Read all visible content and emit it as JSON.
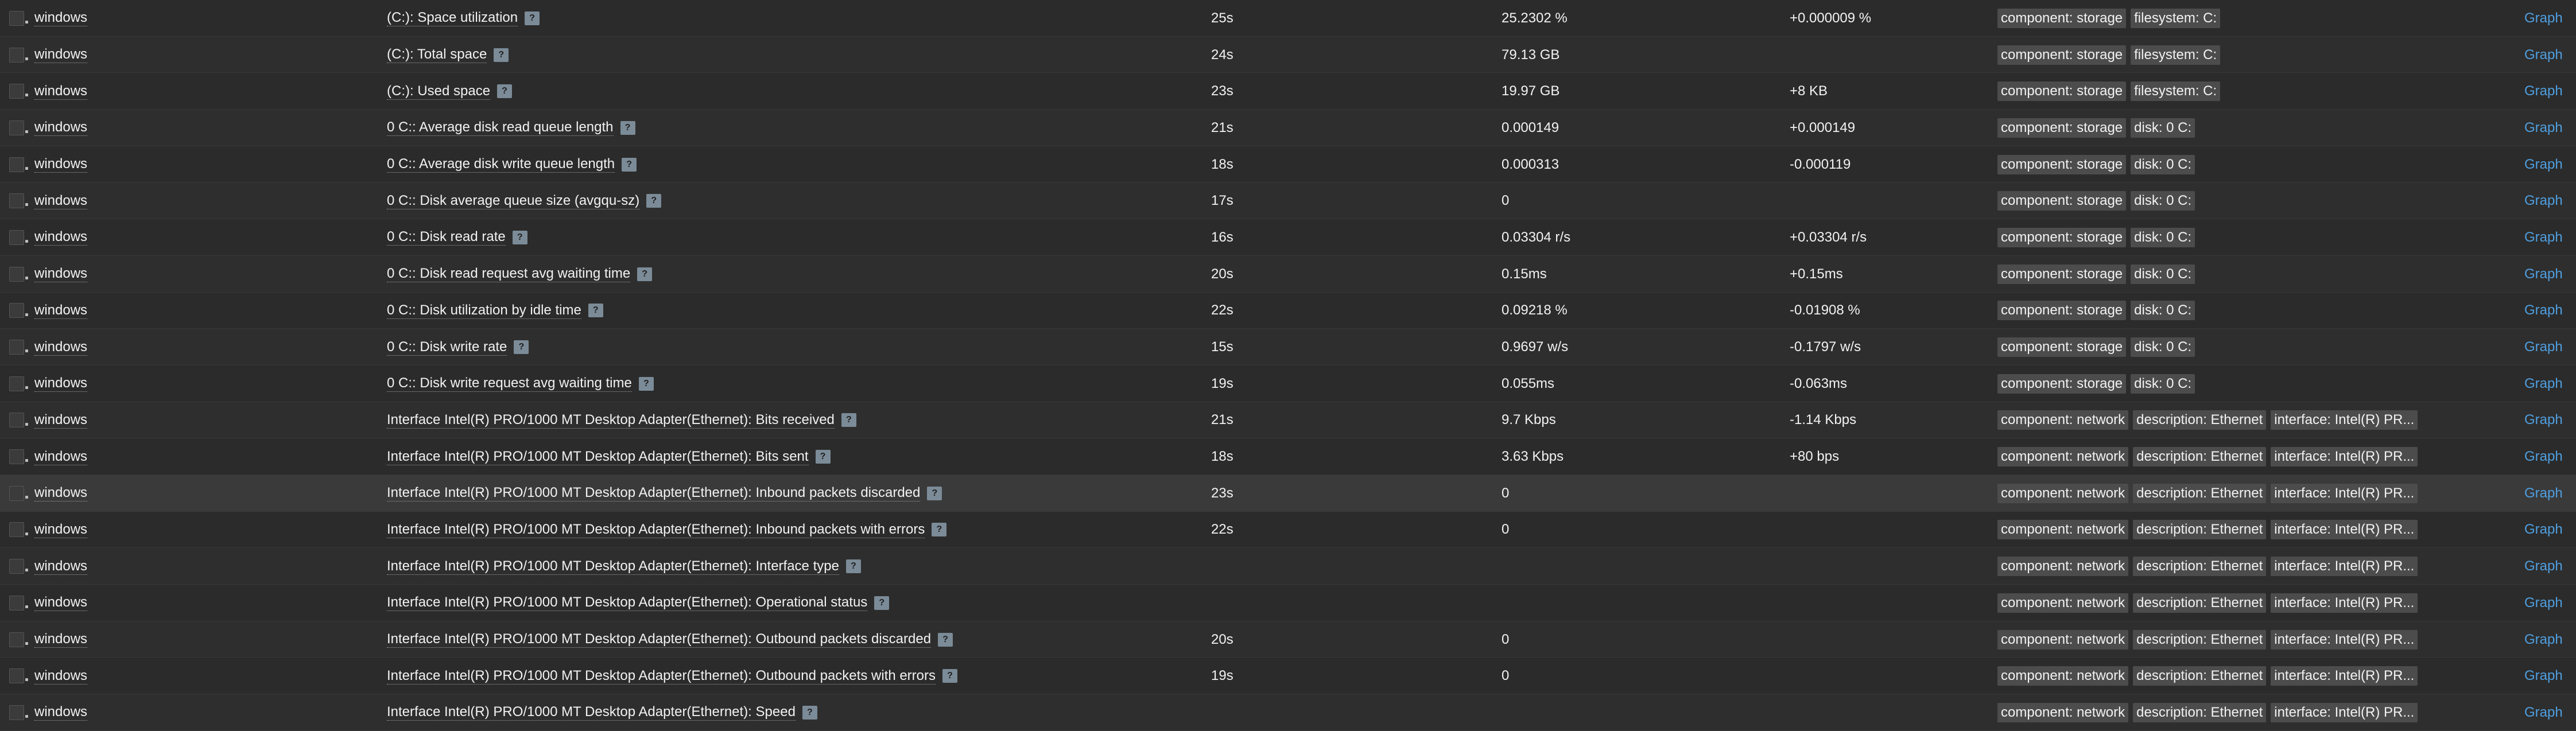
{
  "colors": {
    "background": "#2b2b2b",
    "link_blue": "#4f9fe0",
    "tag_bg": "#4c4c4c",
    "help_bg": "#7b8b97"
  },
  "help_label": "?",
  "rows": [
    {
      "host": "windows",
      "name": "(C:): Space utilization",
      "last_check": "25s",
      "last_value": "25.2302 %",
      "change": "+0.000009 %",
      "tags": [
        "component: storage",
        "filesystem: C:"
      ],
      "action": "Graph"
    },
    {
      "host": "windows",
      "name": "(C:): Total space",
      "last_check": "24s",
      "last_value": "79.13 GB",
      "change": "",
      "tags": [
        "component: storage",
        "filesystem: C:"
      ],
      "action": "Graph"
    },
    {
      "host": "windows",
      "name": "(C:): Used space",
      "last_check": "23s",
      "last_value": "19.97 GB",
      "change": "+8 KB",
      "tags": [
        "component: storage",
        "filesystem: C:"
      ],
      "action": "Graph"
    },
    {
      "host": "windows",
      "name": "0 C:: Average disk read queue length",
      "last_check": "21s",
      "last_value": "0.000149",
      "change": "+0.000149",
      "tags": [
        "component: storage",
        "disk: 0 C:"
      ],
      "action": "Graph"
    },
    {
      "host": "windows",
      "name": "0 C:: Average disk write queue length",
      "last_check": "18s",
      "last_value": "0.000313",
      "change": "-0.000119",
      "tags": [
        "component: storage",
        "disk: 0 C:"
      ],
      "action": "Graph"
    },
    {
      "host": "windows",
      "name": "0 C:: Disk average queue size (avgqu-sz)",
      "last_check": "17s",
      "last_value": "0",
      "change": "",
      "tags": [
        "component: storage",
        "disk: 0 C:"
      ],
      "action": "Graph"
    },
    {
      "host": "windows",
      "name": "0 C:: Disk read rate",
      "last_check": "16s",
      "last_value": "0.03304 r/s",
      "change": "+0.03304 r/s",
      "tags": [
        "component: storage",
        "disk: 0 C:"
      ],
      "action": "Graph"
    },
    {
      "host": "windows",
      "name": "0 C:: Disk read request avg waiting time",
      "last_check": "20s",
      "last_value": "0.15ms",
      "change": "+0.15ms",
      "tags": [
        "component: storage",
        "disk: 0 C:"
      ],
      "action": "Graph"
    },
    {
      "host": "windows",
      "name": "0 C:: Disk utilization by idle time",
      "last_check": "22s",
      "last_value": "0.09218 %",
      "change": "-0.01908 %",
      "tags": [
        "component: storage",
        "disk: 0 C:"
      ],
      "action": "Graph"
    },
    {
      "host": "windows",
      "name": "0 C:: Disk write rate",
      "last_check": "15s",
      "last_value": "0.9697 w/s",
      "change": "-0.1797 w/s",
      "tags": [
        "component: storage",
        "disk: 0 C:"
      ],
      "action": "Graph"
    },
    {
      "host": "windows",
      "name": "0 C:: Disk write request avg waiting time",
      "last_check": "19s",
      "last_value": "0.055ms",
      "change": "-0.063ms",
      "tags": [
        "component: storage",
        "disk: 0 C:"
      ],
      "action": "Graph"
    },
    {
      "host": "windows",
      "name": "Interface Intel(R) PRO/1000 MT Desktop Adapter(Ethernet): Bits received",
      "last_check": "21s",
      "last_value": "9.7 Kbps",
      "change": "-1.14 Kbps",
      "tags": [
        "component: network",
        "description: Ethernet",
        "interface: Intel(R) PR..."
      ],
      "action": "Graph"
    },
    {
      "host": "windows",
      "name": "Interface Intel(R) PRO/1000 MT Desktop Adapter(Ethernet): Bits sent",
      "last_check": "18s",
      "last_value": "3.63 Kbps",
      "change": "+80 bps",
      "tags": [
        "component: network",
        "description: Ethernet",
        "interface: Intel(R) PR..."
      ],
      "action": "Graph"
    },
    {
      "host": "windows",
      "name": "Interface Intel(R) PRO/1000 MT Desktop Adapter(Ethernet): Inbound packets discarded",
      "last_check": "23s",
      "last_value": "0",
      "change": "",
      "tags": [
        "component: network",
        "description: Ethernet",
        "interface: Intel(R) PR..."
      ],
      "action": "Graph"
    },
    {
      "host": "windows",
      "name": "Interface Intel(R) PRO/1000 MT Desktop Adapter(Ethernet): Inbound packets with errors",
      "last_check": "22s",
      "last_value": "0",
      "change": "",
      "tags": [
        "component: network",
        "description: Ethernet",
        "interface: Intel(R) PR..."
      ],
      "action": "Graph"
    },
    {
      "host": "windows",
      "name": "Interface Intel(R) PRO/1000 MT Desktop Adapter(Ethernet): Interface type",
      "last_check": "",
      "last_value": "",
      "change": "",
      "tags": [
        "component: network",
        "description: Ethernet",
        "interface: Intel(R) PR..."
      ],
      "action": "Graph"
    },
    {
      "host": "windows",
      "name": "Interface Intel(R) PRO/1000 MT Desktop Adapter(Ethernet): Operational status",
      "last_check": "",
      "last_value": "",
      "change": "",
      "tags": [
        "component: network",
        "description: Ethernet",
        "interface: Intel(R) PR..."
      ],
      "action": "Graph"
    },
    {
      "host": "windows",
      "name": "Interface Intel(R) PRO/1000 MT Desktop Adapter(Ethernet): Outbound packets discarded",
      "last_check": "20s",
      "last_value": "0",
      "change": "",
      "tags": [
        "component: network",
        "description: Ethernet",
        "interface: Intel(R) PR..."
      ],
      "action": "Graph"
    },
    {
      "host": "windows",
      "name": "Interface Intel(R) PRO/1000 MT Desktop Adapter(Ethernet): Outbound packets with errors",
      "last_check": "19s",
      "last_value": "0",
      "change": "",
      "tags": [
        "component: network",
        "description: Ethernet",
        "interface: Intel(R) PR..."
      ],
      "action": "Graph"
    },
    {
      "host": "windows",
      "name": "Interface Intel(R) PRO/1000 MT Desktop Adapter(Ethernet): Speed",
      "last_check": "",
      "last_value": "",
      "change": "",
      "tags": [
        "component: network",
        "description: Ethernet",
        "interface: Intel(R) PR..."
      ],
      "action": "Graph"
    }
  ]
}
